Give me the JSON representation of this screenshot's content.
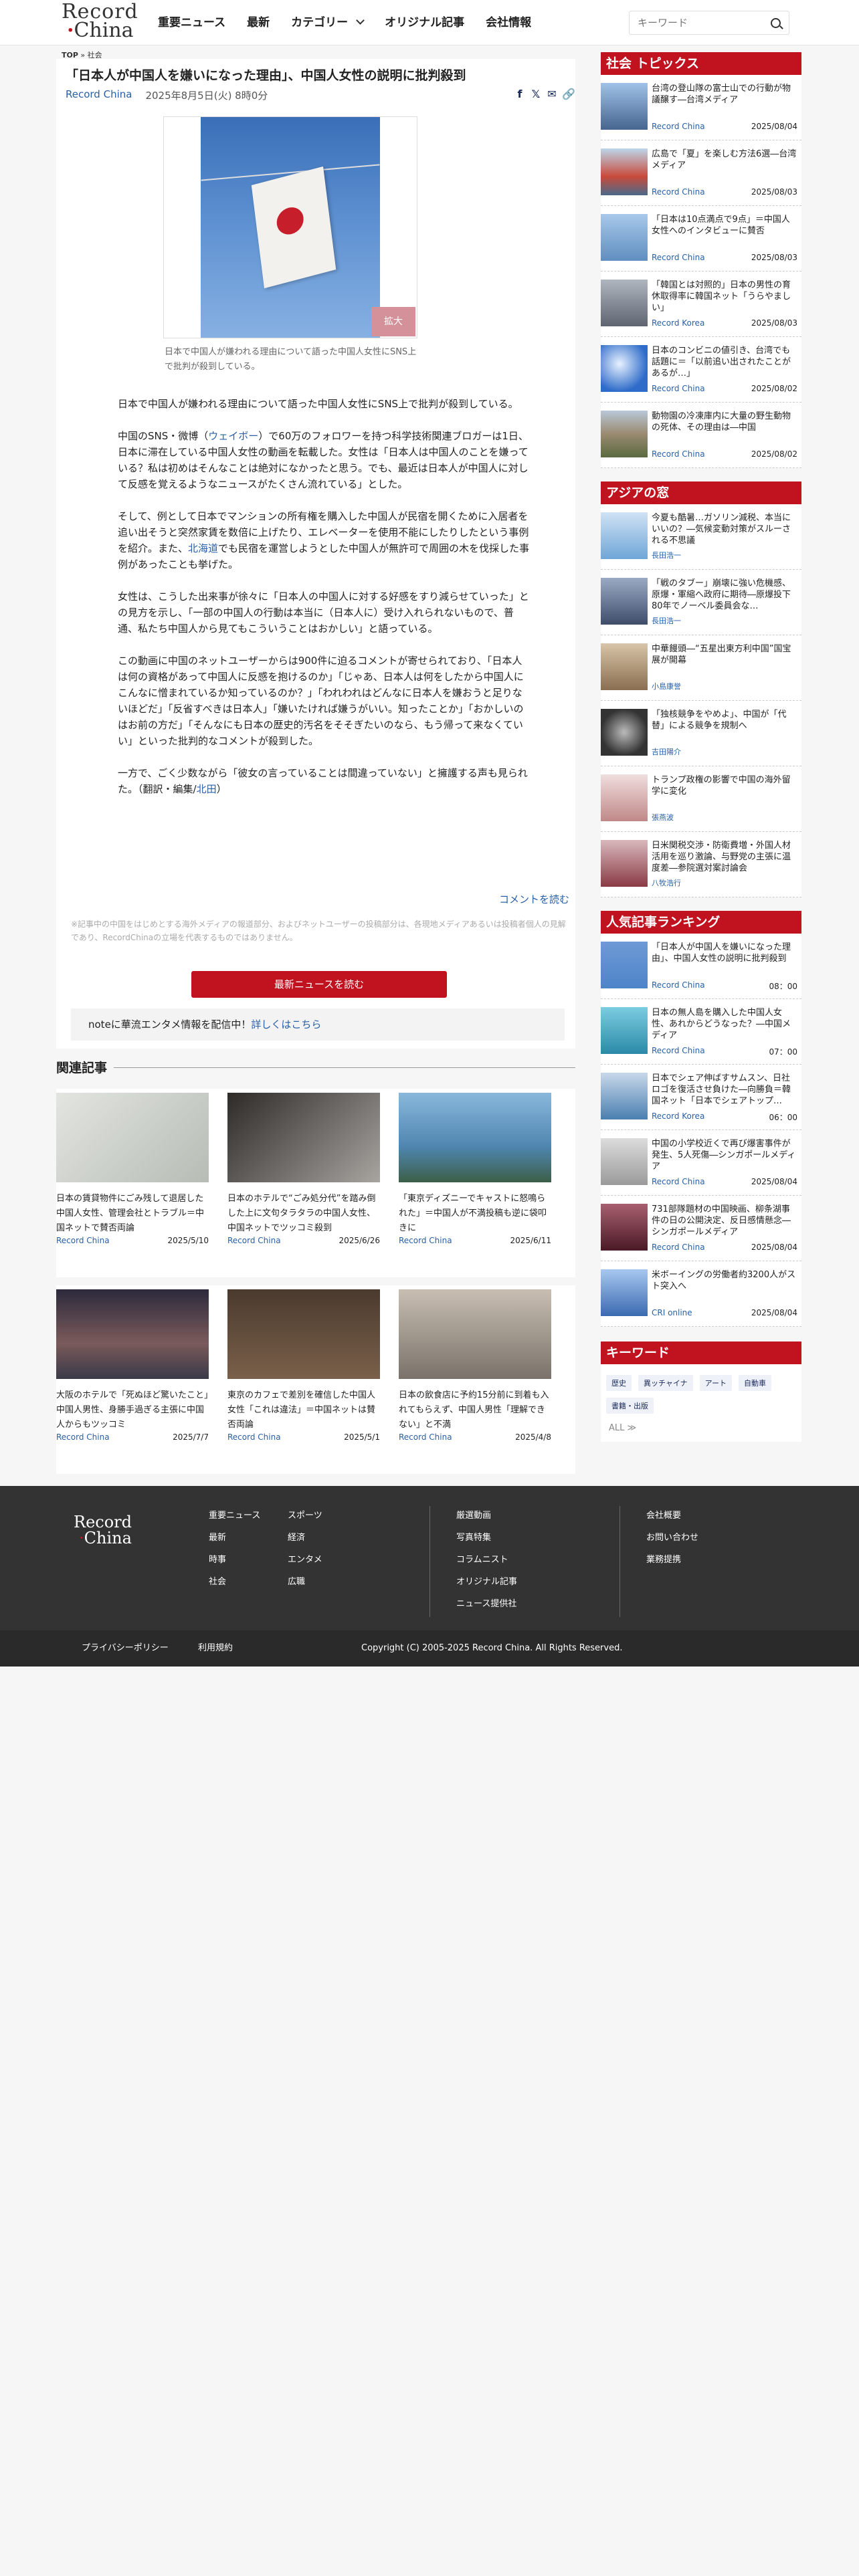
{
  "header": {
    "logo_line1": "Record",
    "logo_line2": "China",
    "nav": [
      "重要ニュース",
      "最新",
      "カテゴリー",
      "オリジナル記事",
      "会社情報"
    ],
    "search_placeholder": "キーワード"
  },
  "breadcrumb": {
    "top": "TOP",
    "sep": "»",
    "current": "社会"
  },
  "article": {
    "title": "「日本人が中国人を嫌いになった理由」、中国人女性の説明に批判殺到",
    "source": "Record China",
    "date": "2025年8月5日(火) 8時0分",
    "share_icons": [
      "facebook-icon",
      "x-icon",
      "mail-icon",
      "link-icon"
    ],
    "enlarge": "拡大",
    "caption": "日本で中国人が嫌われる理由について語った中国人女性にSNS上で批判が殺到している。",
    "p1": "日本で中国人が嫌われる理由について語った中国人女性にSNS上で批判が殺到している。",
    "p2a": "中国のSNS・微博（",
    "p2link": "ウェイボー",
    "p2b": "）で60万のフォロワーを持つ科学技術関連ブロガーは1日、日本に滞在している中国人女性の動画を転載した。女性は「日本人は中国人のことを嫌っている？私は初めはそんなことは絶対になかったと思う。でも、最近は日本人が中国人に対して反感を覚えるようなニュースがたくさん流れている」とした。",
    "p3a": "そして、例として日本でマンションの所有権を購入した中国人が民宿を開くために入居者を追い出そうと突然家賃を数倍に上げたり、エレベーターを使用不能にしたりしたという事例を紹介。また、",
    "p3link": "北海道",
    "p3b": "でも民宿を運営しようとした中国人が無許可で周囲の木を伐採した事例があったことも挙げた。",
    "p4": "女性は、こうした出来事が徐々に「日本人の中国人に対する好感をすり減らせていった」との見方を示し、「一部の中国人の行動は本当に（日本人に）受け入れられないもので、普通、私たち中国人から見てもこういうことはおかしい」と語っている。",
    "p5": "この動画に中国のネットユーザーからは900件に迫るコメントが寄せられており、「日本人は何の資格があって中国人に反感を抱けるのか」「じゃあ、日本人は何をしたから中国人にこんなに憎まれているか知っているのか？」「われわれはどんなに日本人を嫌おうと足りないほどだ」「反省すべきは日本人」「嫌いたければ嫌うがいい。知ったことか」「おかしいのはお前の方だ」「そんなにも日本の歴史的汚名をそそぎたいのなら、もう帰って来なくていい」といった批判的なコメントが殺到した。",
    "p6a": "一方で、ごく少数ながら「彼女の言っていることは間違っていない」と擁護する声も見られた。（翻訳・編集/",
    "p6link": "北田",
    "p6b": "）",
    "comment_link": "コメントを読む",
    "disclaimer": "※記事中の中国をはじめとする海外メディアの報道部分、およびネットユーザーの投稿部分は、各現地メディアあるいは投稿者個人の見解であり、RecordChinaの立場を代表するものではありません。",
    "latest_button": "最新ニュースを読む",
    "note_text": "noteに華流エンタメ情報を配信中！",
    "note_link": "詳しくはこちら"
  },
  "related": {
    "heading": "関連記事",
    "items": [
      {
        "title": "日本の賃貸物件にごみ残して退居した中国人女性、管理会社とトラブル＝中国ネットで賛否両論",
        "source": "Record China",
        "date": "2025/5/10",
        "color": "#cfd3cf"
      },
      {
        "title": "日本のホテルで“ごみ処分代”を踏み倒した上に文句タラタラの中国人女性、中国ネットでツッコミ殺到",
        "source": "Record China",
        "date": "2025/6/26",
        "color": "#7e7b7a"
      },
      {
        "title": "「東京ディズニーでキャストに怒鳴られた」＝中国人が不満投稿も逆に袋叩きに",
        "source": "Record China",
        "date": "2025/6/11",
        "color": "#6da2c9"
      },
      {
        "title": "大阪のホテルで「死ぬほど驚いたこと」中国人男性、身勝手過ぎる主張に中国人からもツッコミ",
        "source": "Record China",
        "date": "2025/7/7",
        "color": "#4d4a5a"
      },
      {
        "title": "東京のカフェで差別を確信した中国人女性「これは違法」＝中国ネットは賛否両論",
        "source": "Record China",
        "date": "2025/5/1",
        "color": "#5a4638"
      },
      {
        "title": "日本の飲食店に予約15分前に到着も入れてもらえず、中国人男性「理解できない」と不満",
        "source": "Record China",
        "date": "2025/4/8",
        "color": "#a39c94"
      }
    ]
  },
  "sidebar": {
    "social": {
      "heading": "社会 トピックス",
      "items": [
        {
          "title": "台湾の登山隊の富士山での行動が物議醸す―台湾メディア",
          "source": "Record China",
          "date": "2025/08/04",
          "color": "#5b7fb0"
        },
        {
          "title": "広島で「夏」を楽しむ方法6選―台湾メディア",
          "source": "Record China",
          "date": "2025/08/03",
          "color": "#c94a3c"
        },
        {
          "title": "「日本は10点満点で9点」＝中国人女性へのインタビューに賛否",
          "source": "Record China",
          "date": "2025/08/03",
          "color": "#7ea6d6"
        },
        {
          "title": "「韓国とは対照的」日本の男性の育休取得率に韓国ネット「うらやましい」",
          "source": "Record Korea",
          "date": "2025/08/03",
          "color": "#8a8f99"
        },
        {
          "title": "日本のコンビニの値引き、台湾でも話題に＝「以前追い出されたことがあるが…」",
          "source": "Record China",
          "date": "2025/08/02",
          "color": "#2f6cc9"
        },
        {
          "title": "動物園の冷凍庫内に大量の野生動物の死体、その理由は―中国",
          "source": "Record China",
          "date": "2025/08/02",
          "color": "#9a8a70"
        }
      ]
    },
    "asia": {
      "heading": "アジアの窓",
      "items": [
        {
          "title": "今夏も酷暑…ガソリン減税、本当にいいの？―気候変動対策がスルーされる不思議",
          "author": "長田浩一",
          "color": "#6fa6d8"
        },
        {
          "title": "「戦のタブー」崩壊に強い危機感、原爆・軍縮へ政府に期待―原爆投下80年でノーベル委員会な…",
          "author": "長田浩一",
          "color": "#3f4d6a"
        },
        {
          "title": "中華饅頭―“五星出東方利中国”国宝展が開幕",
          "author": "小島康誉",
          "color": "#b89a78"
        },
        {
          "title": "「独核競争をやめよ」、中国が「代替」による競争を規制へ",
          "author": "吉田陽介",
          "color": "#4a4a4a"
        },
        {
          "title": "トランプ政権の影響で中国の海外留学に変化",
          "author": "張燕波",
          "color": "#d8a8a8"
        },
        {
          "title": "日米関税交渉・防衛費増・外国人材活用を巡り激論、与野党の主張に温度差―参院選対案討論会",
          "author": "八牧浩行",
          "color": "#8a3a44"
        }
      ]
    },
    "ranking": {
      "heading": "人気記事ランキング",
      "items": [
        {
          "title": "「日本人が中国人を嫌いになった理由」、中国人女性の説明に批判殺到",
          "source": "Record China",
          "date": "08：00",
          "color": "#4d84c8"
        },
        {
          "title": "日本の無人島を購入した中国人女性、あれからどうなった？―中国メディア",
          "source": "Record China",
          "date": "07：00",
          "color": "#3c9ab6"
        },
        {
          "title": "日本でシェア伸ばすサムスン、日社ロゴを復活させ負けた―向勝負＝韓国ネット「日本でシェアトップ…",
          "source": "Record Korea",
          "date": "06：00",
          "color": "#4a7fb0"
        },
        {
          "title": "中国の小学校近くで再び爆害事件が発生、5人死傷―シンガポールメディア",
          "source": "Record China",
          "date": "2025/08/04",
          "color": "#b8b8b8"
        },
        {
          "title": "731部隊題材の中国映画、柳条湖事件の日の公開決定、反日感情懸念―シンガポールメディア",
          "source": "Record China",
          "date": "2025/08/04",
          "color": "#6b2a36"
        },
        {
          "title": "米ボーイングの労働者約3200人がスト突入へ",
          "source": "CRI online",
          "date": "2025/08/04",
          "color": "#5a8ed0"
        }
      ]
    },
    "keywords": {
      "heading": "キーワード",
      "tags": [
        "歴史",
        "異ッチャイナ",
        "アート",
        "自動車",
        "書籍・出版"
      ],
      "all": "ALL ≫"
    }
  },
  "footer": {
    "logo_line1": "Record",
    "logo_line2": "China",
    "col1": [
      "重要ニュース",
      "最新",
      "時事",
      "社会"
    ],
    "col2": [
      "スポーツ",
      "経済",
      "エンタメ",
      "広職"
    ],
    "col3": [
      "厳選動画",
      "写真特集",
      "コラムニスト",
      "オリジナル記事",
      "ニュース提供社"
    ],
    "col4": [
      "会社概要",
      "お問い合わせ",
      "業務提携"
    ],
    "privacy": "プライバシーポリシー",
    "terms": "利用規約",
    "copyright": "Copyright (C) 2005-2025 Record China. All Rights Reserved."
  },
  "colors": {
    "accent": "#c1121f",
    "link": "#2860a8",
    "footer": "#333333"
  }
}
